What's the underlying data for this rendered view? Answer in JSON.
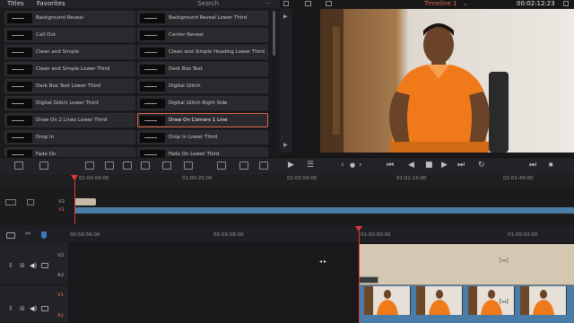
{
  "top": {
    "tabs": [
      "Titles",
      "Favorites"
    ],
    "search_label": "Search",
    "more": "···",
    "timeline_name": "Timeline 1",
    "timecode": "00:02:12:23",
    "dropdown": "⌄"
  },
  "titles": [
    {
      "left": "Background Reveal",
      "right": "Background Reveal Lower Third"
    },
    {
      "left": "Call Out",
      "right": "Center Reveal"
    },
    {
      "left": "Clean and Simple",
      "right": "Clean and Simple Heading Lower Third"
    },
    {
      "left": "Clean and Simple Lower Third",
      "right": "Dark Box Text"
    },
    {
      "left": "Dark Box Text Lower Third",
      "right": "Digital Glitch"
    },
    {
      "left": "Digital Glitch Lower Third",
      "right": "Digital Glitch Right Side"
    },
    {
      "left": "Draw On 2 Lines Lower Third",
      "right": "Draw On Corners 1 Line"
    },
    {
      "left": "Drop In",
      "right": "Drop In Lower Third"
    },
    {
      "left": "Fade On",
      "right": "Fade On Lower Third"
    }
  ],
  "selected_title": "Draw On Corners 1 Line",
  "upper_timeline": {
    "ruler": [
      "01:00:00:00",
      "01:00:25:00",
      "01:00:50:00",
      "01:01:15:00",
      "01:01:40:00"
    ],
    "tracks": [
      "V2",
      "V1"
    ]
  },
  "lower_timeline": {
    "ruler": [
      "00:59:56:00",
      "00:59:58:00",
      "01:00:00:00",
      "01:00:02:00"
    ],
    "tracks": [
      "V2",
      "A2",
      "V1",
      "A1"
    ],
    "clip_marker": "[↔]",
    "nav_arrows": "◂ ▸"
  },
  "colors": {
    "accent": "#e0674a",
    "playhead": "#e53935",
    "v1_track": "#4a7ca8",
    "title_clip": "#c8bca6",
    "audio_clip": "#d4c8b2"
  }
}
